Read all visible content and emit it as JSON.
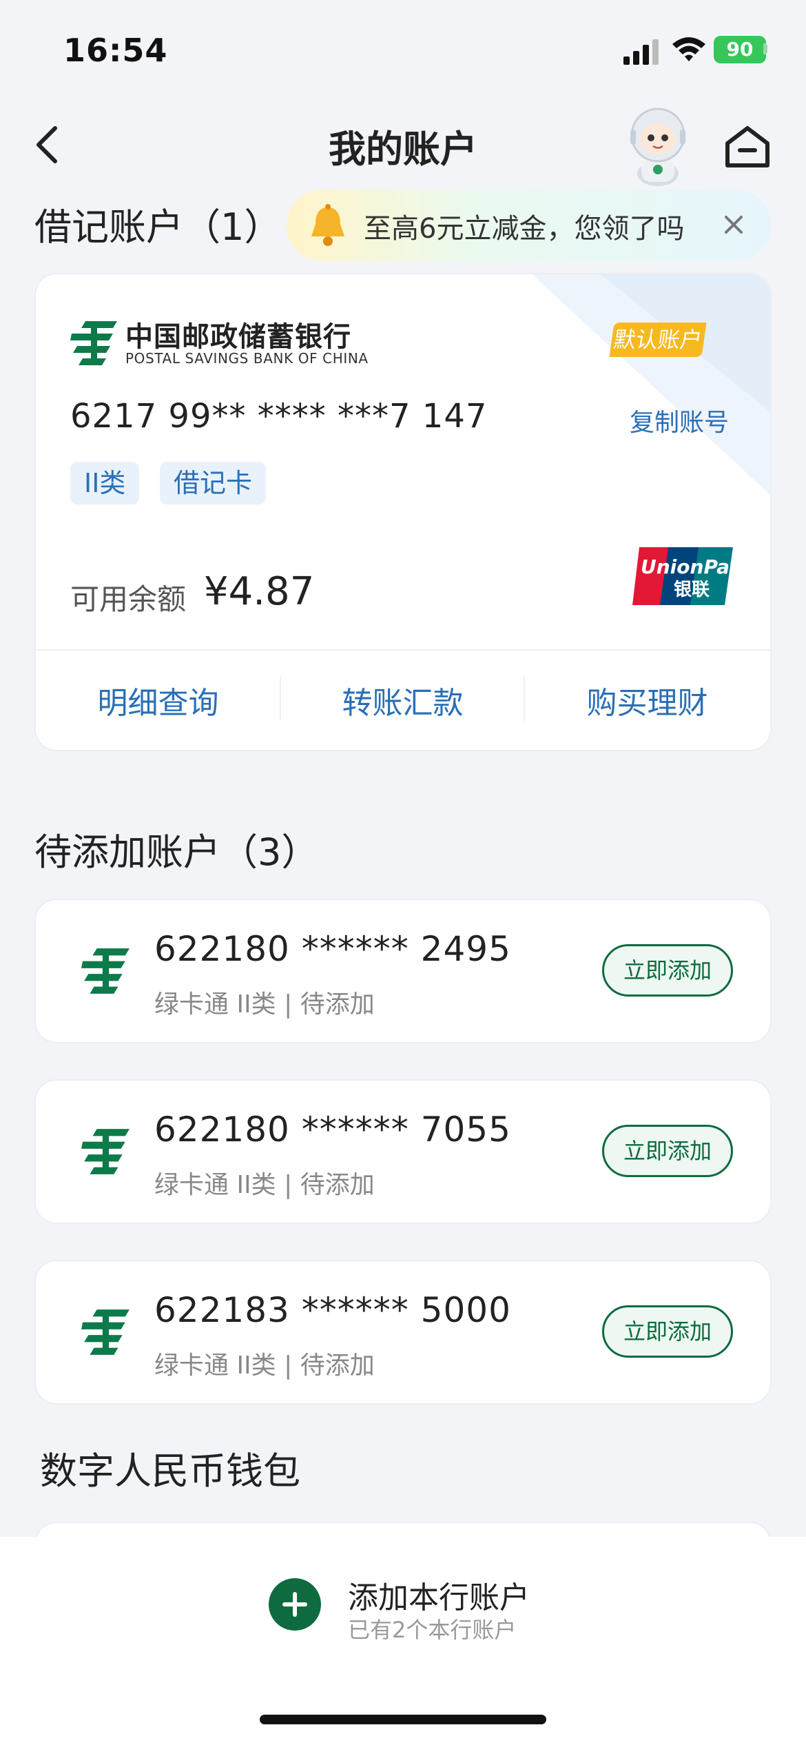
{
  "status_bar": {
    "time": "16:54",
    "battery": "90"
  },
  "nav": {
    "title": "我的账户"
  },
  "debit_section": {
    "title": "借记账户（1）"
  },
  "promo": {
    "text": "至高6元立减金，您领了吗"
  },
  "debit_card": {
    "bank_name_cn": "中国邮政储蓄银行",
    "bank_name_en": "POSTAL SAVINGS BANK OF CHINA",
    "badge": "默认账户",
    "number": "6217 99** **** ***7 147",
    "copy_label": "复制账号",
    "tags": [
      "II类",
      "借记卡"
    ],
    "balance_label": "可用余额",
    "balance": "¥4.87",
    "actions": [
      "明细查询",
      "转账汇款",
      "购买理财"
    ]
  },
  "pending_section": {
    "title": "待添加账户（3）"
  },
  "pending_accounts": [
    {
      "number": "622180 ****** 2495",
      "sub": "绿卡通 II类 | 待添加",
      "button": "立即添加"
    },
    {
      "number": "622180 ****** 7055",
      "sub": "绿卡通 II类 | 待添加",
      "button": "立即添加"
    },
    {
      "number": "622183 ****** 5000",
      "sub": "绿卡通 II类 | 待添加",
      "button": "立即添加"
    }
  ],
  "wallet_section": {
    "title": "数字人民币钱包"
  },
  "bottom_bar": {
    "add_label": "添加本行账户",
    "add_sub": "已有2个本行账户"
  },
  "colors": {
    "brand_green": "#0d6b3f",
    "link_blue": "#2a6fb6",
    "badge_yellow": "#f8b820"
  },
  "icons": [
    "back-arrow-icon",
    "robot-avatar",
    "home-icon",
    "bell-icon",
    "close-icon",
    "psbc-logo-icon",
    "unionpay-logo",
    "plus-icon"
  ]
}
